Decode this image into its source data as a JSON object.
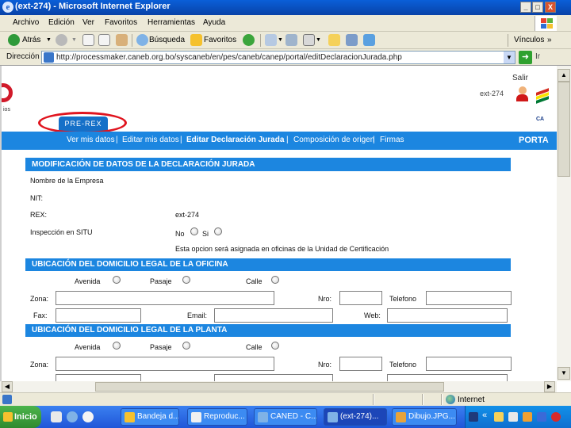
{
  "window": {
    "title": "(ext-274) - Microsoft Internet Explorer",
    "minimize": "_",
    "maximize": "□",
    "close": "X"
  },
  "menu": [
    "Archivo",
    "Edición",
    "Ver",
    "Favoritos",
    "Herramientas",
    "Ayuda"
  ],
  "toolbar": {
    "back_label": "Atrás",
    "search_label": "Búsqueda",
    "favorites_label": "Favoritos",
    "links_label": "Vínculos"
  },
  "address": {
    "label": "Dirección",
    "url": "http://processmaker.caneb.org.bo/syscaneb/en/pes/caneb/canep/portal/editDeclaracionJurada.php",
    "go_label": "Ir"
  },
  "page": {
    "logo_text": "ios",
    "salir": "Salir",
    "user_id": "ext-274",
    "can_text": "CA",
    "tab_label": "PRE-REX",
    "nav": {
      "items": [
        "Ver mis datos",
        "Editar mis datos",
        "Editar Declaración Jurada",
        "Composición de origen",
        "Firmas"
      ],
      "separator": "|",
      "brand": "PORTA"
    },
    "section_title": "MODIFICACIÓN DE DATOS DE LA DECLARACIÓN JURADA",
    "fields": {
      "empresa_label": "Nombre de la Empresa",
      "nit_label": "NIT:",
      "rex_label": "REX:",
      "rex_value": "ext-274",
      "inspeccion_label": "Inspección en SITU",
      "no_label": "No",
      "si_label": "Si",
      "note": "Esta opcion será asignada en oficinas de la Unidad de Certificación"
    },
    "oficina": {
      "title": "UBICACIÓN DEL DOMICILIO LEGAL DE LA OFICINA",
      "avenida": "Avenida",
      "pasaje": "Pasaje",
      "calle": "Calle",
      "zona": "Zona:",
      "nro": "Nro:",
      "telefono": "Telefono",
      "fax": "Fax:",
      "email": "Email:",
      "web": "Web:"
    },
    "planta": {
      "title": "UBICACIÓN DEL DOMICILIO LEGAL DE LA PLANTA",
      "avenida": "Avenida",
      "pasaje": "Pasaje",
      "calle": "Calle",
      "zona": "Zona:",
      "nro": "Nro:",
      "telefono": "Telefono"
    }
  },
  "statusbar": {
    "zone": "Internet"
  },
  "taskbar": {
    "start": "Inicio",
    "more": "»",
    "tasks": [
      "Bandeja d...",
      "Reproduc...",
      "CANED - C...",
      "(ext-274)...",
      "Dibujo.JPG..."
    ],
    "tray_arrows": "«"
  },
  "colors": {
    "brand_blue": "#1c86e0",
    "tab_blue": "#1570c8",
    "highlight_red": "#e0141e"
  }
}
